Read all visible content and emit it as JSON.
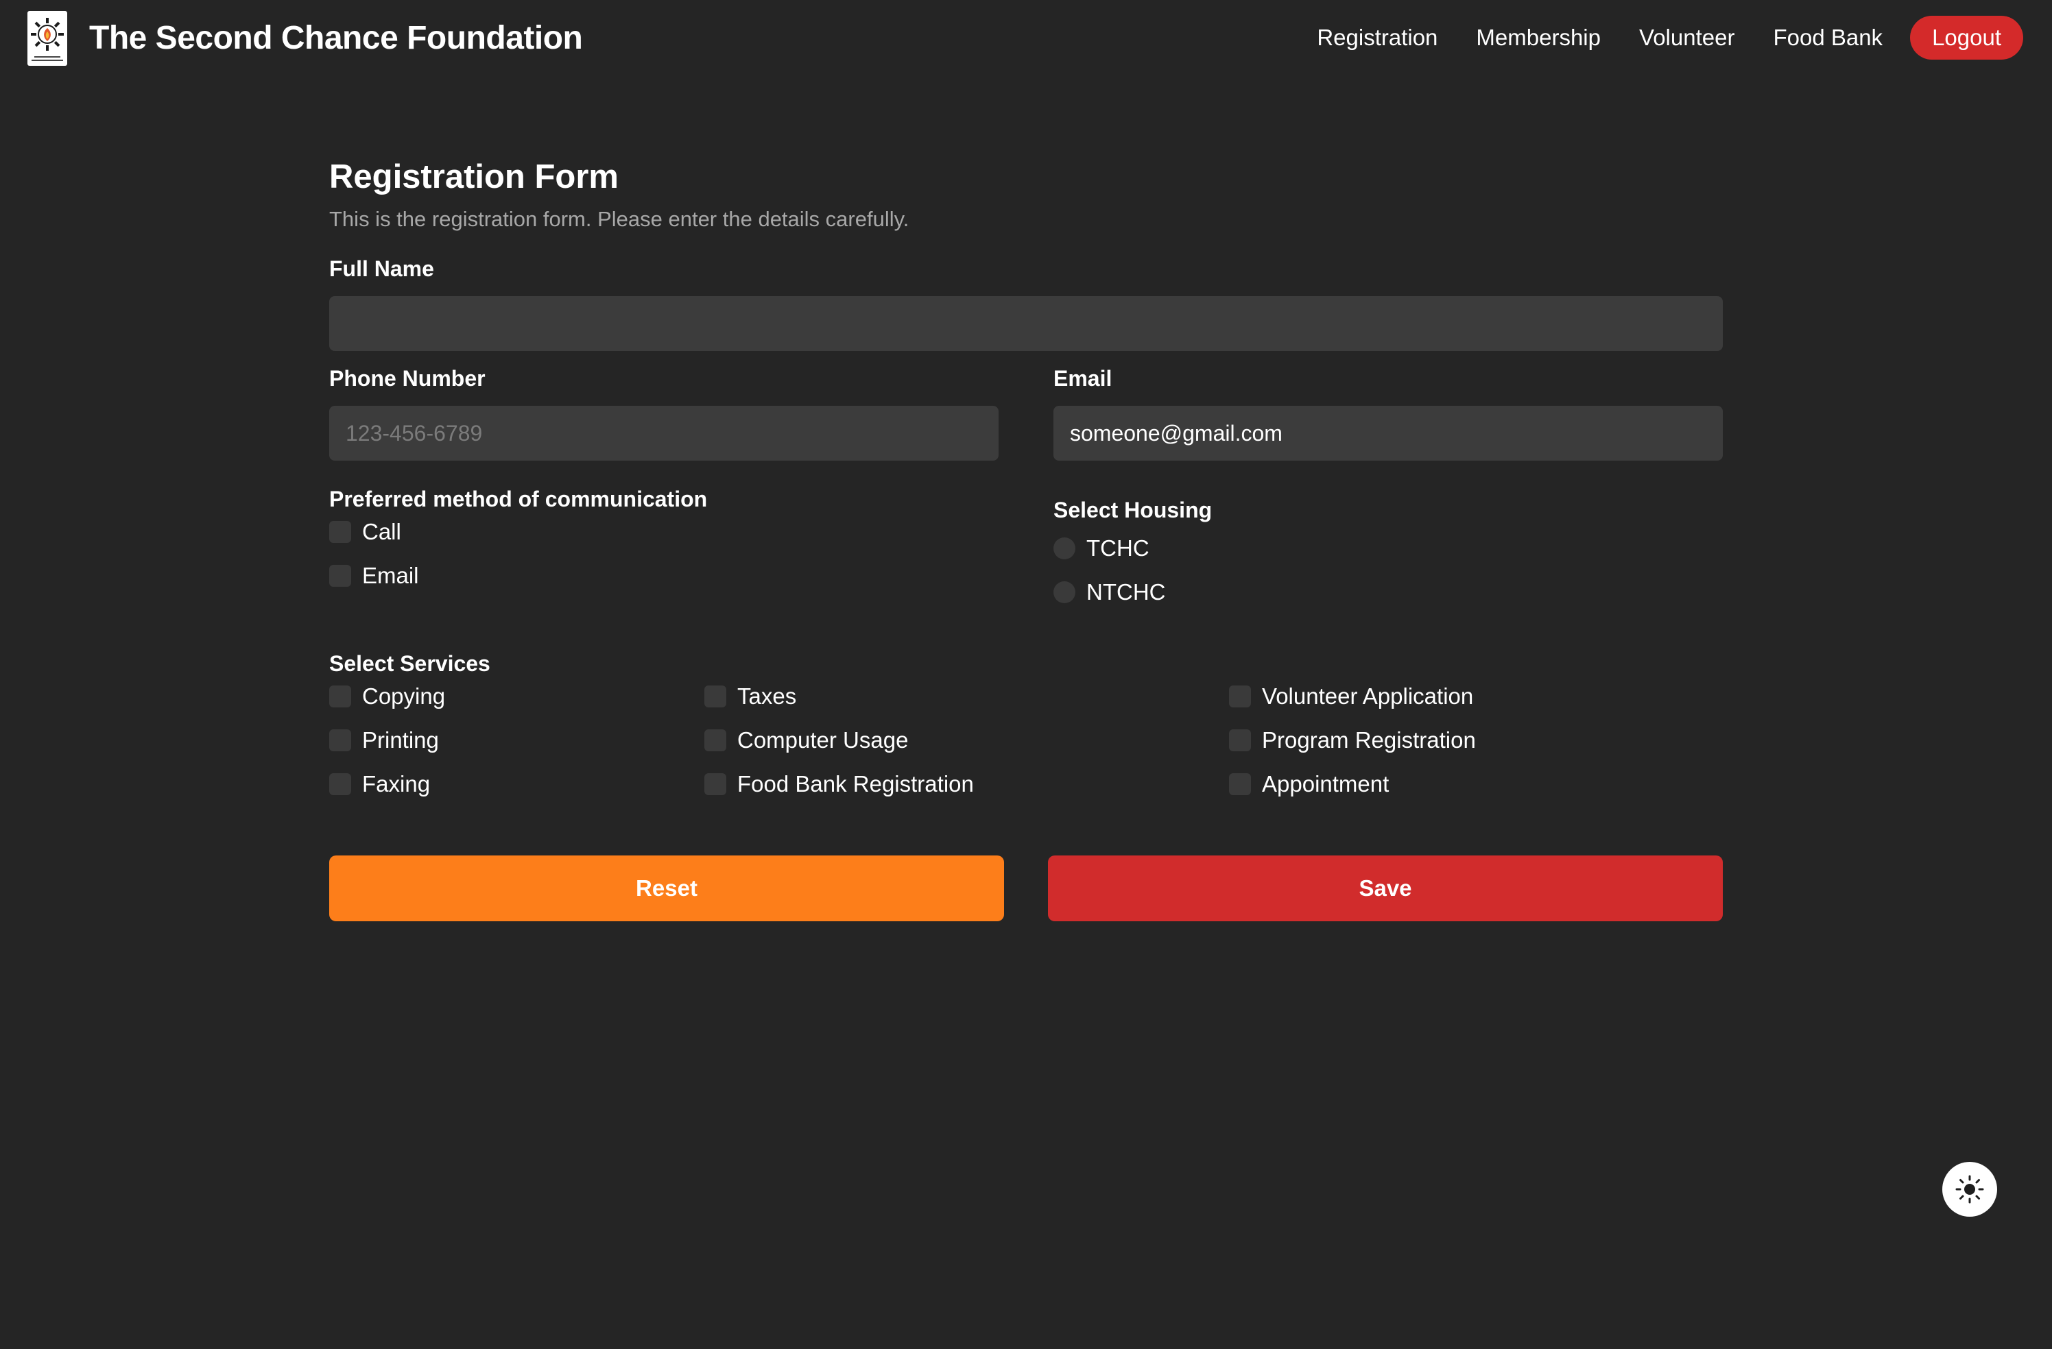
{
  "header": {
    "brand": "The Second Chance Foundation",
    "logo_icon": "foundation-logo-icon",
    "nav": [
      "Registration",
      "Membership",
      "Volunteer",
      "Food Bank"
    ],
    "logout_label": "Logout"
  },
  "form": {
    "title": "Registration Form",
    "subtitle": "This is the registration form. Please enter the details carefully.",
    "full_name": {
      "label": "Full Name",
      "value": "",
      "placeholder": ""
    },
    "phone": {
      "label": "Phone Number",
      "value": "",
      "placeholder": "123-456-6789"
    },
    "email": {
      "label": "Email",
      "value": "someone@gmail.com",
      "placeholder": ""
    },
    "communication": {
      "label": "Preferred method of communication",
      "options": [
        "Call",
        "Email"
      ]
    },
    "housing": {
      "label": "Select Housing",
      "options": [
        "TCHC",
        "NTCHC"
      ]
    },
    "services": {
      "label": "Select Services",
      "options": [
        "Copying",
        "Printing",
        "Faxing",
        "Taxes",
        "Computer Usage",
        "Food Bank Registration",
        "Volunteer Application",
        "Program Registration",
        "Appointment"
      ]
    },
    "reset_label": "Reset",
    "save_label": "Save"
  },
  "theme_toggle": {
    "icon": "sun-icon"
  },
  "colors": {
    "background": "#252525",
    "input_bg": "#3c3c3c",
    "accent_red": "#d12c2c",
    "accent_orange": "#fd7e1a"
  }
}
